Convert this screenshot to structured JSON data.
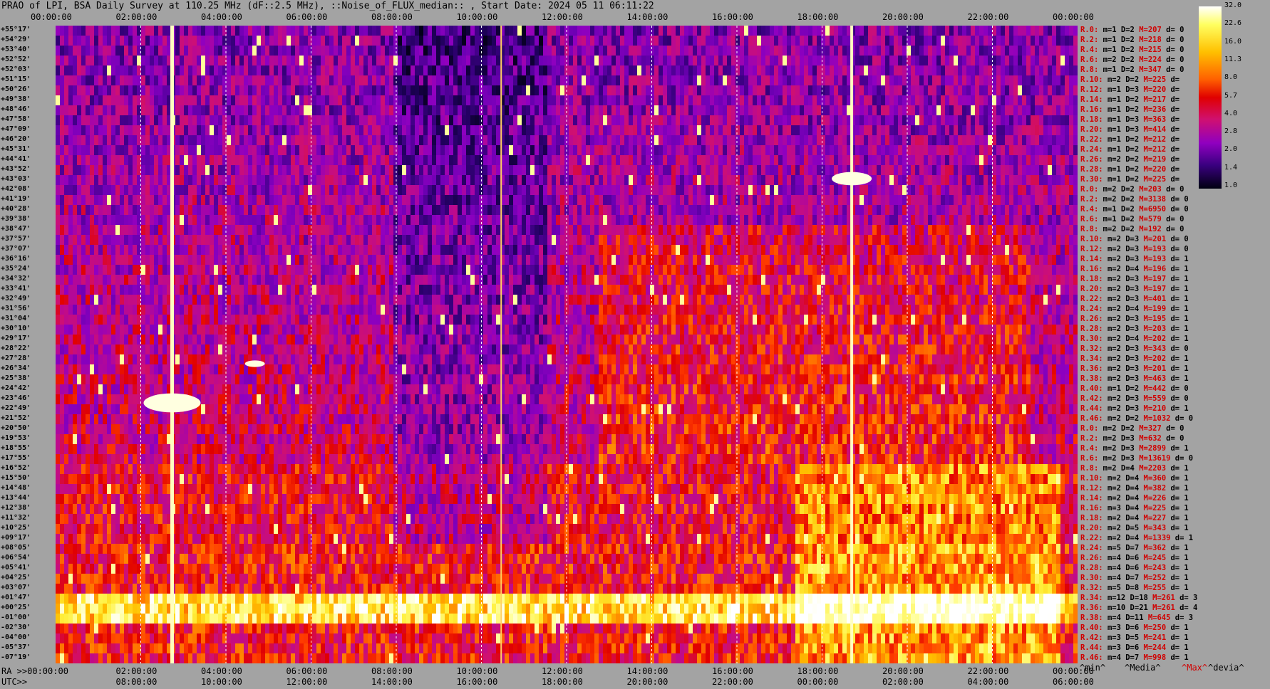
{
  "title": "PRAO of LPI, BSA Daily Survey at 110.25 MHz (dF::2.5 MHz), ::Noise_of_FLUX_median:: , Start Date: 2024 05 11 06:11:22",
  "chart_data": {
    "type": "heatmap",
    "title": "PRAO of LPI, BSA Daily Survey at 110.25 MHz (dF::2.5 MHz), ::Noise_of_FLUX_median:: , Start Date: 2024 05 11 06:11:22",
    "x_ra_top_ticks": [
      "00:00:00",
      "02:00:00",
      "04:00:00",
      "06:00:00",
      "08:00:00",
      "10:00:00",
      "12:00:00",
      "14:00:00",
      "16:00:00",
      "18:00:00",
      "20:00:00",
      "22:00:00",
      "00:00:00"
    ],
    "x_ra_bottom_ticks": [
      "RA >>00:00:00",
      "02:00:00",
      "04:00:00",
      "06:00:00",
      "08:00:00",
      "10:00:00",
      "12:00:00",
      "14:00:00",
      "16:00:00",
      "18:00:00",
      "20:00:00",
      "22:00:00",
      "00:00:00"
    ],
    "x_utc_ticks": [
      "UTC>>",
      "08:00:00",
      "10:00:00",
      "12:00:00",
      "14:00:00",
      "16:00:00",
      "18:00:00",
      "20:00:00",
      "22:00:00",
      "00:00:00",
      "02:00:00",
      "04:00:00",
      "06:00:00"
    ],
    "colorbar_ticks": [
      "32.0",
      "22.6",
      "16.0",
      "11.3",
      "8.0",
      "5.7",
      "4.0",
      "2.8",
      "2.0",
      "1.4",
      "1.0"
    ],
    "colorbar_scale": "log",
    "legend_footer": [
      "^min^",
      "^Media^",
      "^Max^",
      "^devia^"
    ],
    "declinations": [
      "+55°17'",
      "+54°29'",
      "+53°40'",
      "+52°52'",
      "+52°03'",
      "+51°15'",
      "+50°26'",
      "+49°38'",
      "+48°46'",
      "+47°58'",
      "+47°09'",
      "+46°20'",
      "+45°31'",
      "+44°41'",
      "+43°52'",
      "+43°03'",
      "+42°08'",
      "+41°19'",
      "+40°28'",
      "+39°38'",
      "+38°47'",
      "+37°57'",
      "+37°07'",
      "+36°16'",
      "+35°24'",
      "+34°32'",
      "+33°41'",
      "+32°49'",
      "+31°56'",
      "+31°04'",
      "+30°10'",
      "+29°17'",
      "+28°22'",
      "+27°28'",
      "+26°34'",
      "+25°38'",
      "+24°42'",
      "+23°46'",
      "+22°49'",
      "+21°52'",
      "+20°50'",
      "+19°53'",
      "+18°55'",
      "+17°55'",
      "+16°52'",
      "+15°50'",
      "+14°48'",
      "+13°44'",
      "+12°38'",
      "+11°32'",
      "+10°25'",
      "+09°17'",
      "+08°05'",
      "+06°54'",
      "+05°41'",
      "+04°25'",
      "+03°07'",
      "+01°47'",
      "+00°25'",
      "-01°00'",
      "-02°30'",
      "-04°00'",
      "-05°37'",
      "-07°19'"
    ],
    "beam_stats": [
      {
        "r": "R.0:",
        "m": "m=1",
        "d": "D=2",
        "M": "M=207",
        "dev": "d= 0"
      },
      {
        "r": "R.2:",
        "m": "m=1",
        "d": "D=2",
        "M": "M=218",
        "dev": "d= 0"
      },
      {
        "r": "R.4:",
        "m": "m=1",
        "d": "D=2",
        "M": "M=215",
        "dev": "d= 0"
      },
      {
        "r": "R.6:",
        "m": "m=2",
        "d": "D=2",
        "M": "M=224",
        "dev": "d= 0"
      },
      {
        "r": "R.8:",
        "m": "m=1",
        "d": "D=2",
        "M": "M=347",
        "dev": "d= 0"
      },
      {
        "r": "R.10:",
        "m": "m=2",
        "d": "D=2",
        "M": "M=225",
        "dev": "d="
      },
      {
        "r": "R.12:",
        "m": "m=1",
        "d": "D=3",
        "M": "M=220",
        "dev": "d="
      },
      {
        "r": "R.14:",
        "m": "m=1",
        "d": "D=2",
        "M": "M=217",
        "dev": "d="
      },
      {
        "r": "R.16:",
        "m": "m=1",
        "d": "D=2",
        "M": "M=236",
        "dev": "d="
      },
      {
        "r": "R.18:",
        "m": "m=1",
        "d": "D=3",
        "M": "M=363",
        "dev": "d="
      },
      {
        "r": "R.20:",
        "m": "m=1",
        "d": "D=3",
        "M": "M=414",
        "dev": "d="
      },
      {
        "r": "R.22:",
        "m": "m=1",
        "d": "D=2",
        "M": "M=212",
        "dev": "d="
      },
      {
        "r": "R.24:",
        "m": "m=1",
        "d": "D=2",
        "M": "M=212",
        "dev": "d="
      },
      {
        "r": "R.26:",
        "m": "m=2",
        "d": "D=2",
        "M": "M=219",
        "dev": "d="
      },
      {
        "r": "R.28:",
        "m": "m=1",
        "d": "D=2",
        "M": "M=220",
        "dev": "d="
      },
      {
        "r": "R.30:",
        "m": "m=1",
        "d": "D=2",
        "M": "M=225",
        "dev": "d="
      },
      {
        "r": "R.0:",
        "m": "m=2",
        "d": "D=2",
        "M": "M=203",
        "dev": "d= 0"
      },
      {
        "r": "R.2:",
        "m": "m=2",
        "d": "D=2",
        "M": "M=3138",
        "dev": "d= 0"
      },
      {
        "r": "R.4:",
        "m": "m=1",
        "d": "D=2",
        "M": "M=6950",
        "dev": "d= 0"
      },
      {
        "r": "R.6:",
        "m": "m=1",
        "d": "D=2",
        "M": "M=579",
        "dev": "d= 0"
      },
      {
        "r": "R.8:",
        "m": "m=2",
        "d": "D=2",
        "M": "M=192",
        "dev": "d= 0"
      },
      {
        "r": "R.10:",
        "m": "m=2",
        "d": "D=3",
        "M": "M=201",
        "dev": "d= 0"
      },
      {
        "r": "R.12:",
        "m": "m=2",
        "d": "D=3",
        "M": "M=193",
        "dev": "d= 0"
      },
      {
        "r": "R.14:",
        "m": "m=2",
        "d": "D=3",
        "M": "M=193",
        "dev": "d= 1"
      },
      {
        "r": "R.16:",
        "m": "m=2",
        "d": "D=4",
        "M": "M=196",
        "dev": "d= 1"
      },
      {
        "r": "R.18:",
        "m": "m=2",
        "d": "D=3",
        "M": "M=197",
        "dev": "d= 1"
      },
      {
        "r": "R.20:",
        "m": "m=2",
        "d": "D=3",
        "M": "M=197",
        "dev": "d= 1"
      },
      {
        "r": "R.22:",
        "m": "m=2",
        "d": "D=3",
        "M": "M=401",
        "dev": "d= 1"
      },
      {
        "r": "R.24:",
        "m": "m=2",
        "d": "D=4",
        "M": "M=199",
        "dev": "d= 1"
      },
      {
        "r": "R.26:",
        "m": "m=2",
        "d": "D=3",
        "M": "M=195",
        "dev": "d= 1"
      },
      {
        "r": "R.28:",
        "m": "m=2",
        "d": "D=3",
        "M": "M=203",
        "dev": "d= 1"
      },
      {
        "r": "R.30:",
        "m": "m=2",
        "d": "D=4",
        "M": "M=202",
        "dev": "d= 1"
      },
      {
        "r": "R.32:",
        "m": "m=2",
        "d": "D=3",
        "M": "M=343",
        "dev": "d= 0"
      },
      {
        "r": "R.34:",
        "m": "m=2",
        "d": "D=3",
        "M": "M=202",
        "dev": "d= 1"
      },
      {
        "r": "R.36:",
        "m": "m=2",
        "d": "D=3",
        "M": "M=201",
        "dev": "d= 1"
      },
      {
        "r": "R.38:",
        "m": "m=2",
        "d": "D=3",
        "M": "M=463",
        "dev": "d= 1"
      },
      {
        "r": "R.40:",
        "m": "m=1",
        "d": "D=2",
        "M": "M=442",
        "dev": "d= 0"
      },
      {
        "r": "R.42:",
        "m": "m=2",
        "d": "D=3",
        "M": "M=559",
        "dev": "d= 0"
      },
      {
        "r": "R.44:",
        "m": "m=2",
        "d": "D=3",
        "M": "M=210",
        "dev": "d= 1"
      },
      {
        "r": "R.46:",
        "m": "m=2",
        "d": "D=2",
        "M": "M=1032",
        "dev": "d= 0"
      },
      {
        "r": "R.0:",
        "m": "m=2",
        "d": "D=2",
        "M": "M=327",
        "dev": "d= 0"
      },
      {
        "r": "R.2:",
        "m": "m=2",
        "d": "D=3",
        "M": "M=632",
        "dev": "d= 0"
      },
      {
        "r": "R.4:",
        "m": "m=2",
        "d": "D=3",
        "M": "M=2899",
        "dev": "d= 1"
      },
      {
        "r": "R.6:",
        "m": "m=2",
        "d": "D=3",
        "M": "M=13619",
        "dev": "d= 0"
      },
      {
        "r": "R.8:",
        "m": "m=2",
        "d": "D=4",
        "M": "M=2203",
        "dev": "d= 1"
      },
      {
        "r": "R.10:",
        "m": "m=2",
        "d": "D=4",
        "M": "M=360",
        "dev": "d= 1"
      },
      {
        "r": "R.12:",
        "m": "m=2",
        "d": "D=4",
        "M": "M=382",
        "dev": "d= 1"
      },
      {
        "r": "R.14:",
        "m": "m=2",
        "d": "D=4",
        "M": "M=226",
        "dev": "d= 1"
      },
      {
        "r": "R.16:",
        "m": "m=3",
        "d": "D=4",
        "M": "M=225",
        "dev": "d= 1"
      },
      {
        "r": "R.18:",
        "m": "m=2",
        "d": "D=4",
        "M": "M=227",
        "dev": "d= 1"
      },
      {
        "r": "R.20:",
        "m": "m=2",
        "d": "D=5",
        "M": "M=343",
        "dev": "d= 1"
      },
      {
        "r": "R.22:",
        "m": "m=2",
        "d": "D=4",
        "M": "M=1339",
        "dev": "d= 1"
      },
      {
        "r": "R.24:",
        "m": "m=5",
        "d": "D=7",
        "M": "M=362",
        "dev": "d= 1"
      },
      {
        "r": "R.26:",
        "m": "m=4",
        "d": "D=6",
        "M": "M=245",
        "dev": "d= 1"
      },
      {
        "r": "R.28:",
        "m": "m=4",
        "d": "D=6",
        "M": "M=243",
        "dev": "d= 1"
      },
      {
        "r": "R.30:",
        "m": "m=4",
        "d": "D=7",
        "M": "M=252",
        "dev": "d= 1"
      },
      {
        "r": "R.32:",
        "m": "m=5",
        "d": "D=8",
        "M": "M=255",
        "dev": "d= 1"
      },
      {
        "r": "R.34:",
        "m": "m=12",
        "d": "D=18",
        "M": "M=261",
        "dev": "d= 3"
      },
      {
        "r": "R.36:",
        "m": "m=10",
        "d": "D=21",
        "M": "M=261",
        "dev": "d= 4"
      },
      {
        "r": "R.38:",
        "m": "m=4",
        "d": "D=11",
        "M": "M=645",
        "dev": "d= 3"
      },
      {
        "r": "R.40:",
        "m": "m=3",
        "d": "D=6",
        "M": "M=250",
        "dev": "d= 1"
      },
      {
        "r": "R.42:",
        "m": "m=3",
        "d": "D=5",
        "M": "M=241",
        "dev": "d= 1"
      },
      {
        "r": "R.44:",
        "m": "m=3",
        "d": "D=6",
        "M": "M=244",
        "dev": "d= 1"
      },
      {
        "r": "R.46:",
        "m": "m=4",
        "d": "D=7",
        "M": "M=998",
        "dev": "d= 1"
      }
    ]
  }
}
